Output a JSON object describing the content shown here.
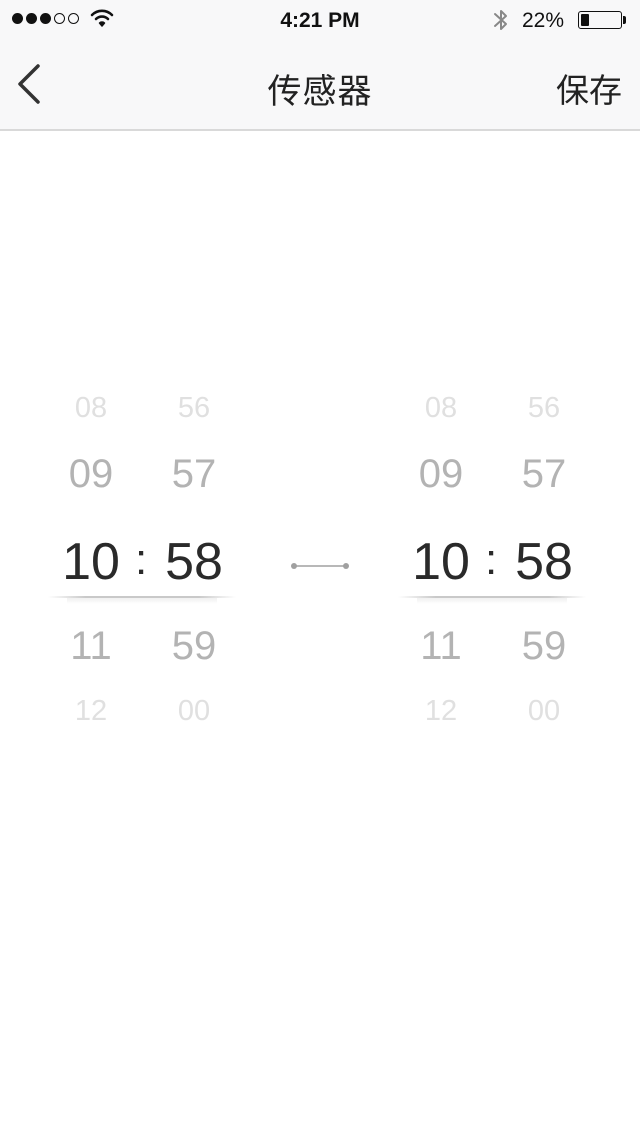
{
  "status_bar": {
    "time": "4:21 PM",
    "battery_percent_text": "22%",
    "battery_level": 0.22,
    "signal_bars": 3,
    "signal_total": 5,
    "icons": [
      "signal-icon",
      "wifi-icon",
      "bluetooth-icon",
      "battery-icon"
    ]
  },
  "nav": {
    "title": "传感器",
    "save_label": "保存",
    "back_icon": "chevron-left-icon"
  },
  "pickers": [
    {
      "hours": [
        "08",
        "09",
        "10",
        "11",
        "12"
      ],
      "minutes": [
        "56",
        "57",
        "58",
        "59",
        "00"
      ],
      "separator": ":"
    },
    {
      "hours": [
        "08",
        "09",
        "10",
        "11",
        "12"
      ],
      "minutes": [
        "56",
        "57",
        "58",
        "59",
        "00"
      ],
      "separator": ":"
    }
  ],
  "colors": {
    "bar_bg": "#f8f8f9",
    "selected_text": "#2a2a2a",
    "near_text": "#b3b3b3",
    "far_text": "#e0e0e0",
    "connector": "#a0a0a0"
  }
}
